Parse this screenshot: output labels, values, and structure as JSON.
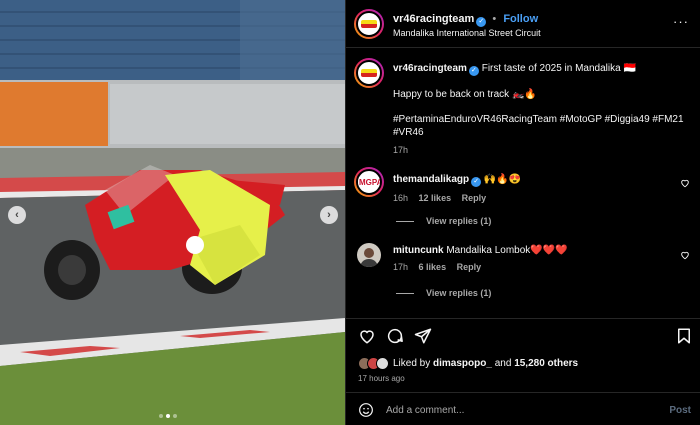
{
  "photo": {
    "alt": "",
    "dots_total": 3,
    "dots_active": 1,
    "prev_glyph": "‹",
    "next_glyph": "›"
  },
  "header": {
    "username": "vr46racingteam",
    "verified": true,
    "separator": "•",
    "follow_label": "Follow",
    "location": "Mandalika International Street Circuit",
    "more_glyph": "···"
  },
  "caption": {
    "username": "vr46racingteam",
    "line1": "First taste of 2025 in Mandalika 🇮🇩",
    "line2": "Happy to be back on track 🏍️🔥",
    "line3": "#PertaminaEnduroVR46RacingTeam #MotoGP #Diggia49 #FM21 #VR46",
    "time": "17h"
  },
  "comments": [
    {
      "username": "themandalikagp",
      "verified": true,
      "text": "🙌🔥😍",
      "time": "16h",
      "likes": "12 likes",
      "reply": "Reply",
      "view_replies": "View replies (1)"
    },
    {
      "username": "mituncunk",
      "verified": false,
      "text": "Mandalika Lombok❤️❤️❤️",
      "time": "17h",
      "likes": "6 likes",
      "reply": "Reply",
      "view_replies": "View replies (1)"
    }
  ],
  "actions": {
    "liked_by_prefix": "Liked by",
    "liked_by_user": "dimaspopo_",
    "liked_by_and": "and",
    "liked_by_count": "15,280 others",
    "time_ago": "17 hours ago"
  },
  "add_comment": {
    "placeholder": "Add a comment...",
    "post_label": "Post"
  },
  "colors": {
    "accent": "#4a9ff5",
    "background": "#000000",
    "verified": "#3897f0",
    "muted": "#a8a8a8"
  },
  "icons": [
    "chevron-left-icon",
    "chevron-right-icon",
    "verified-badge-icon",
    "more-icon",
    "heart-icon",
    "comment-icon",
    "share-icon",
    "bookmark-icon",
    "emoji-icon"
  ]
}
